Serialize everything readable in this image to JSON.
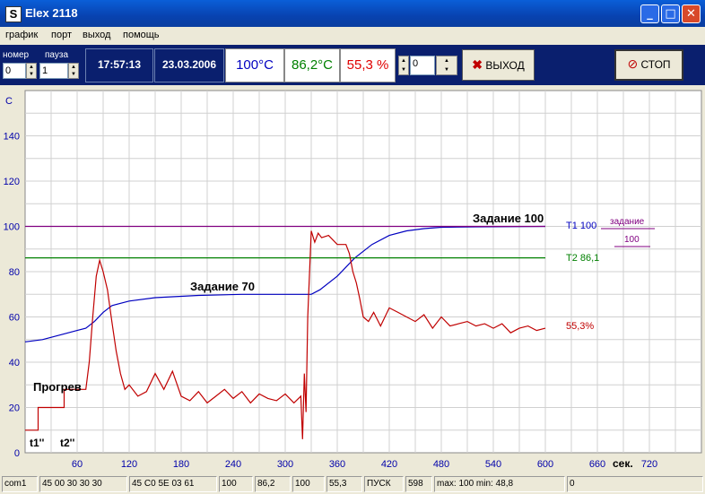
{
  "window": {
    "title": "Elex 2118"
  },
  "menu": [
    "график",
    "порт",
    "выход",
    "помощь"
  ],
  "toolbar": {
    "nomer_label": "номер",
    "pauza_label": "пауза",
    "nomer_value": "0",
    "pauza_value": "1",
    "time": "17:57:13",
    "date": "23.03.2006",
    "t1": "100°C",
    "t2": "86,2°C",
    "power": "55,3 %",
    "counter_value": "0",
    "exit_label": "ВЫХОД",
    "stop_label": "СТОП",
    "colors": {
      "t1": "#0000c0",
      "t2": "#008000",
      "power": "#e00000",
      "bar": "#0a1f6e"
    }
  },
  "chart_data": {
    "type": "line",
    "ylabel": "С",
    "xlabel": "сек.",
    "xlim": [
      0,
      780
    ],
    "ylim": [
      0,
      160
    ],
    "x_ticks": [
      60,
      120,
      180,
      240,
      300,
      360,
      420,
      480,
      540,
      600,
      660,
      720
    ],
    "y_ticks": [
      0,
      20,
      40,
      60,
      80,
      100,
      120,
      140
    ],
    "grid": true,
    "series": [
      {
        "name": "T1 100",
        "color": "#0000c0",
        "x": [
          0,
          20,
          40,
          60,
          70,
          80,
          90,
          100,
          120,
          150,
          200,
          250,
          300,
          320,
          330,
          340,
          360,
          380,
          400,
          420,
          440,
          460,
          480,
          520,
          560,
          600
        ],
        "y": [
          49,
          50,
          52,
          54,
          55,
          58,
          62,
          65,
          67,
          68.5,
          69.5,
          70,
          70,
          70,
          70,
          72,
          78,
          86,
          92,
          96,
          98,
          99,
          99.6,
          99.8,
          99.9,
          100
        ]
      },
      {
        "name": "T2 86,1",
        "color": "#008000",
        "x": [
          0,
          600
        ],
        "y": [
          86.1,
          86.1
        ]
      },
      {
        "name": "задание",
        "color": "#800080",
        "x": [
          0,
          600
        ],
        "y": [
          100,
          100
        ]
      },
      {
        "name": "55,3%",
        "color": "#c00000",
        "x": [
          0,
          15,
          15,
          45,
          45,
          70,
          74,
          78,
          82,
          86,
          90,
          95,
          100,
          105,
          110,
          115,
          120,
          130,
          140,
          150,
          160,
          170,
          180,
          190,
          200,
          210,
          220,
          230,
          240,
          250,
          260,
          270,
          280,
          290,
          300,
          310,
          318,
          320,
          322,
          324,
          326,
          330,
          334,
          338,
          342,
          350,
          360,
          370,
          374,
          378,
          382,
          386,
          390,
          396,
          402,
          410,
          420,
          430,
          440,
          450,
          460,
          470,
          480,
          490,
          500,
          510,
          520,
          530,
          540,
          550,
          560,
          570,
          580,
          590,
          600
        ],
        "y": [
          10,
          10,
          20,
          20,
          28,
          28,
          40,
          60,
          78,
          85,
          80,
          72,
          58,
          45,
          35,
          28,
          30,
          25,
          27,
          35,
          28,
          36,
          25,
          23,
          27,
          22,
          25,
          28,
          24,
          27,
          22,
          26,
          24,
          23,
          26,
          22,
          25,
          6,
          35,
          18,
          60,
          98,
          93,
          97,
          95,
          96,
          92,
          92,
          88,
          80,
          75,
          68,
          60,
          58,
          62,
          56,
          64,
          62,
          60,
          58,
          61,
          55,
          60,
          56,
          57,
          58,
          56,
          57,
          55,
          57,
          53,
          55,
          56,
          54,
          55
        ]
      }
    ],
    "annotations": {
      "heat": "Прогрев",
      "set70": "Задание 70",
      "set100": "Задание 100",
      "t1": "t1''",
      "t2": "t2''",
      "legend_t1": "T1 100",
      "legend_t2": "T2 86,1",
      "legend_pwr": "55,3%",
      "legend_set": "задание",
      "legend_set_val": "100"
    }
  },
  "statusbar": [
    "com1",
    "45 00 30 30 30",
    "45 C0 5E 03 61",
    "100",
    "86,2",
    "100",
    "55,3",
    "ПУСК",
    "598",
    "max: 100  min: 48,8",
    "0"
  ]
}
